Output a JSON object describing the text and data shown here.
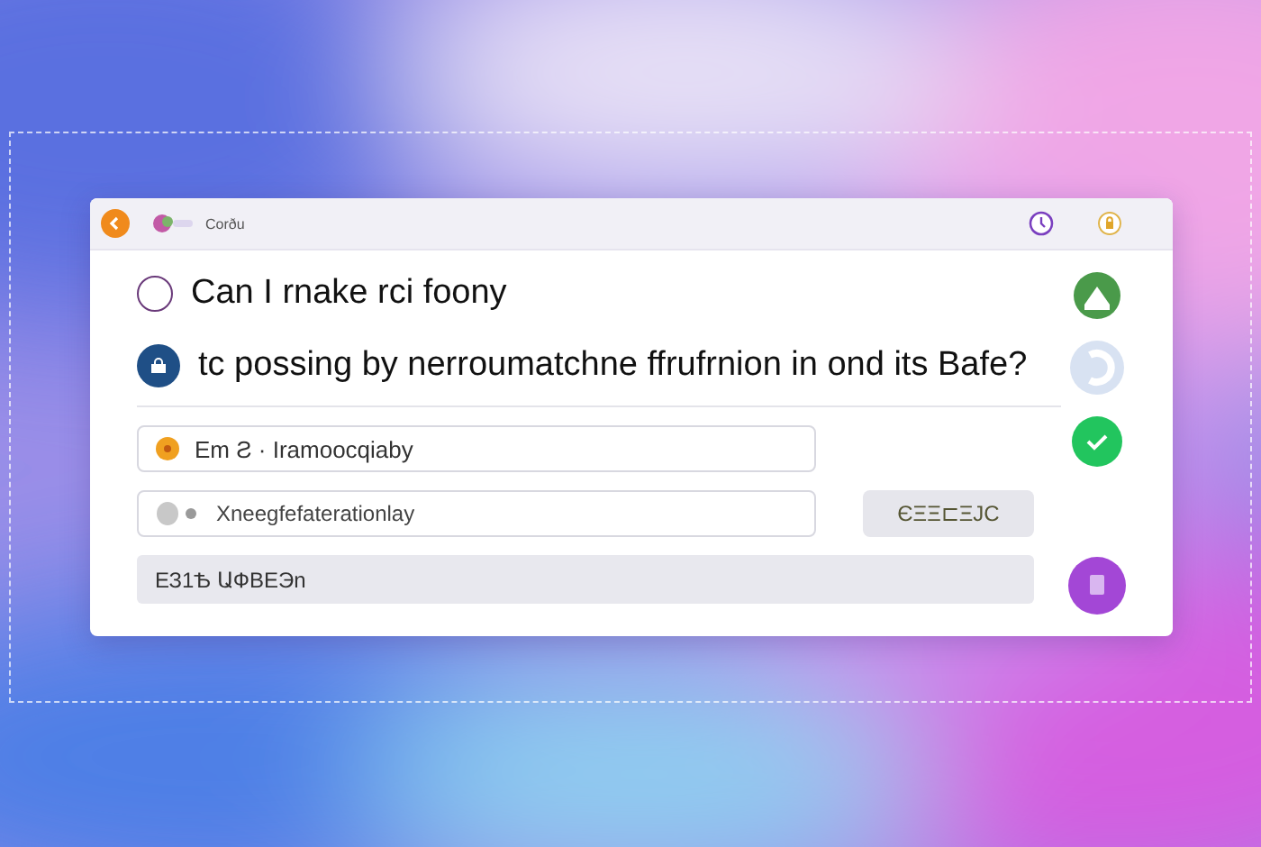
{
  "window": {
    "app_name": "Corðu"
  },
  "questions": [
    {
      "text": "Can I rnake rci fооny",
      "selected": false
    },
    {
      "text": "tc possing by nerroumatchne ffrufrnion in ond its Bafe?",
      "selected": true
    }
  ],
  "fields": [
    {
      "kind": "warning",
      "value": "Em  Ƨ · Iramoocqiaby"
    },
    {
      "kind": "status",
      "value": "Xneegfefaterationlay"
    }
  ],
  "action_button": {
    "label": "ЄΞΞ⊏ΞJC"
  },
  "bottom_bar": {
    "text": "ЕЗ1Ѣ ԱФВЕЭn"
  }
}
